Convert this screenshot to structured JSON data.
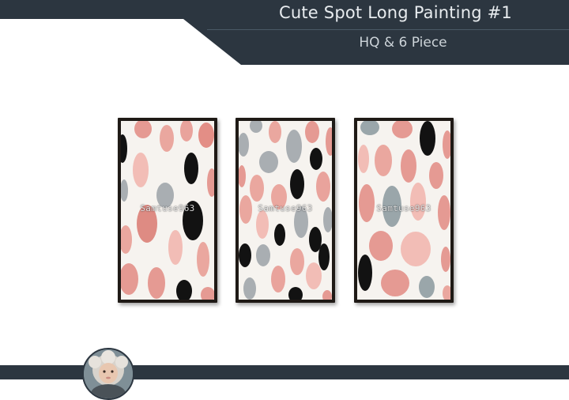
{
  "header": {
    "title": "Cute Spot Long Painting #1",
    "subtitle": "HQ & 6 Piece"
  },
  "colors": {
    "header_bg": "#2c3640",
    "frame": "#1f1a16",
    "canvas": "#f6f3ef",
    "spot_pink": "#e59a93",
    "spot_light_pink": "#f2bdb6",
    "spot_gray": "#a9aeb2",
    "spot_blue_gray": "#9aa6aa",
    "spot_black": "#121212"
  },
  "paintings": [
    {
      "id": "left",
      "watermark": "Samtuse963"
    },
    {
      "id": "center",
      "watermark": "Samtuse963"
    },
    {
      "id": "right",
      "watermark": "Samtuse963"
    }
  ],
  "avatar": {
    "icon": "doll-portrait-icon"
  }
}
